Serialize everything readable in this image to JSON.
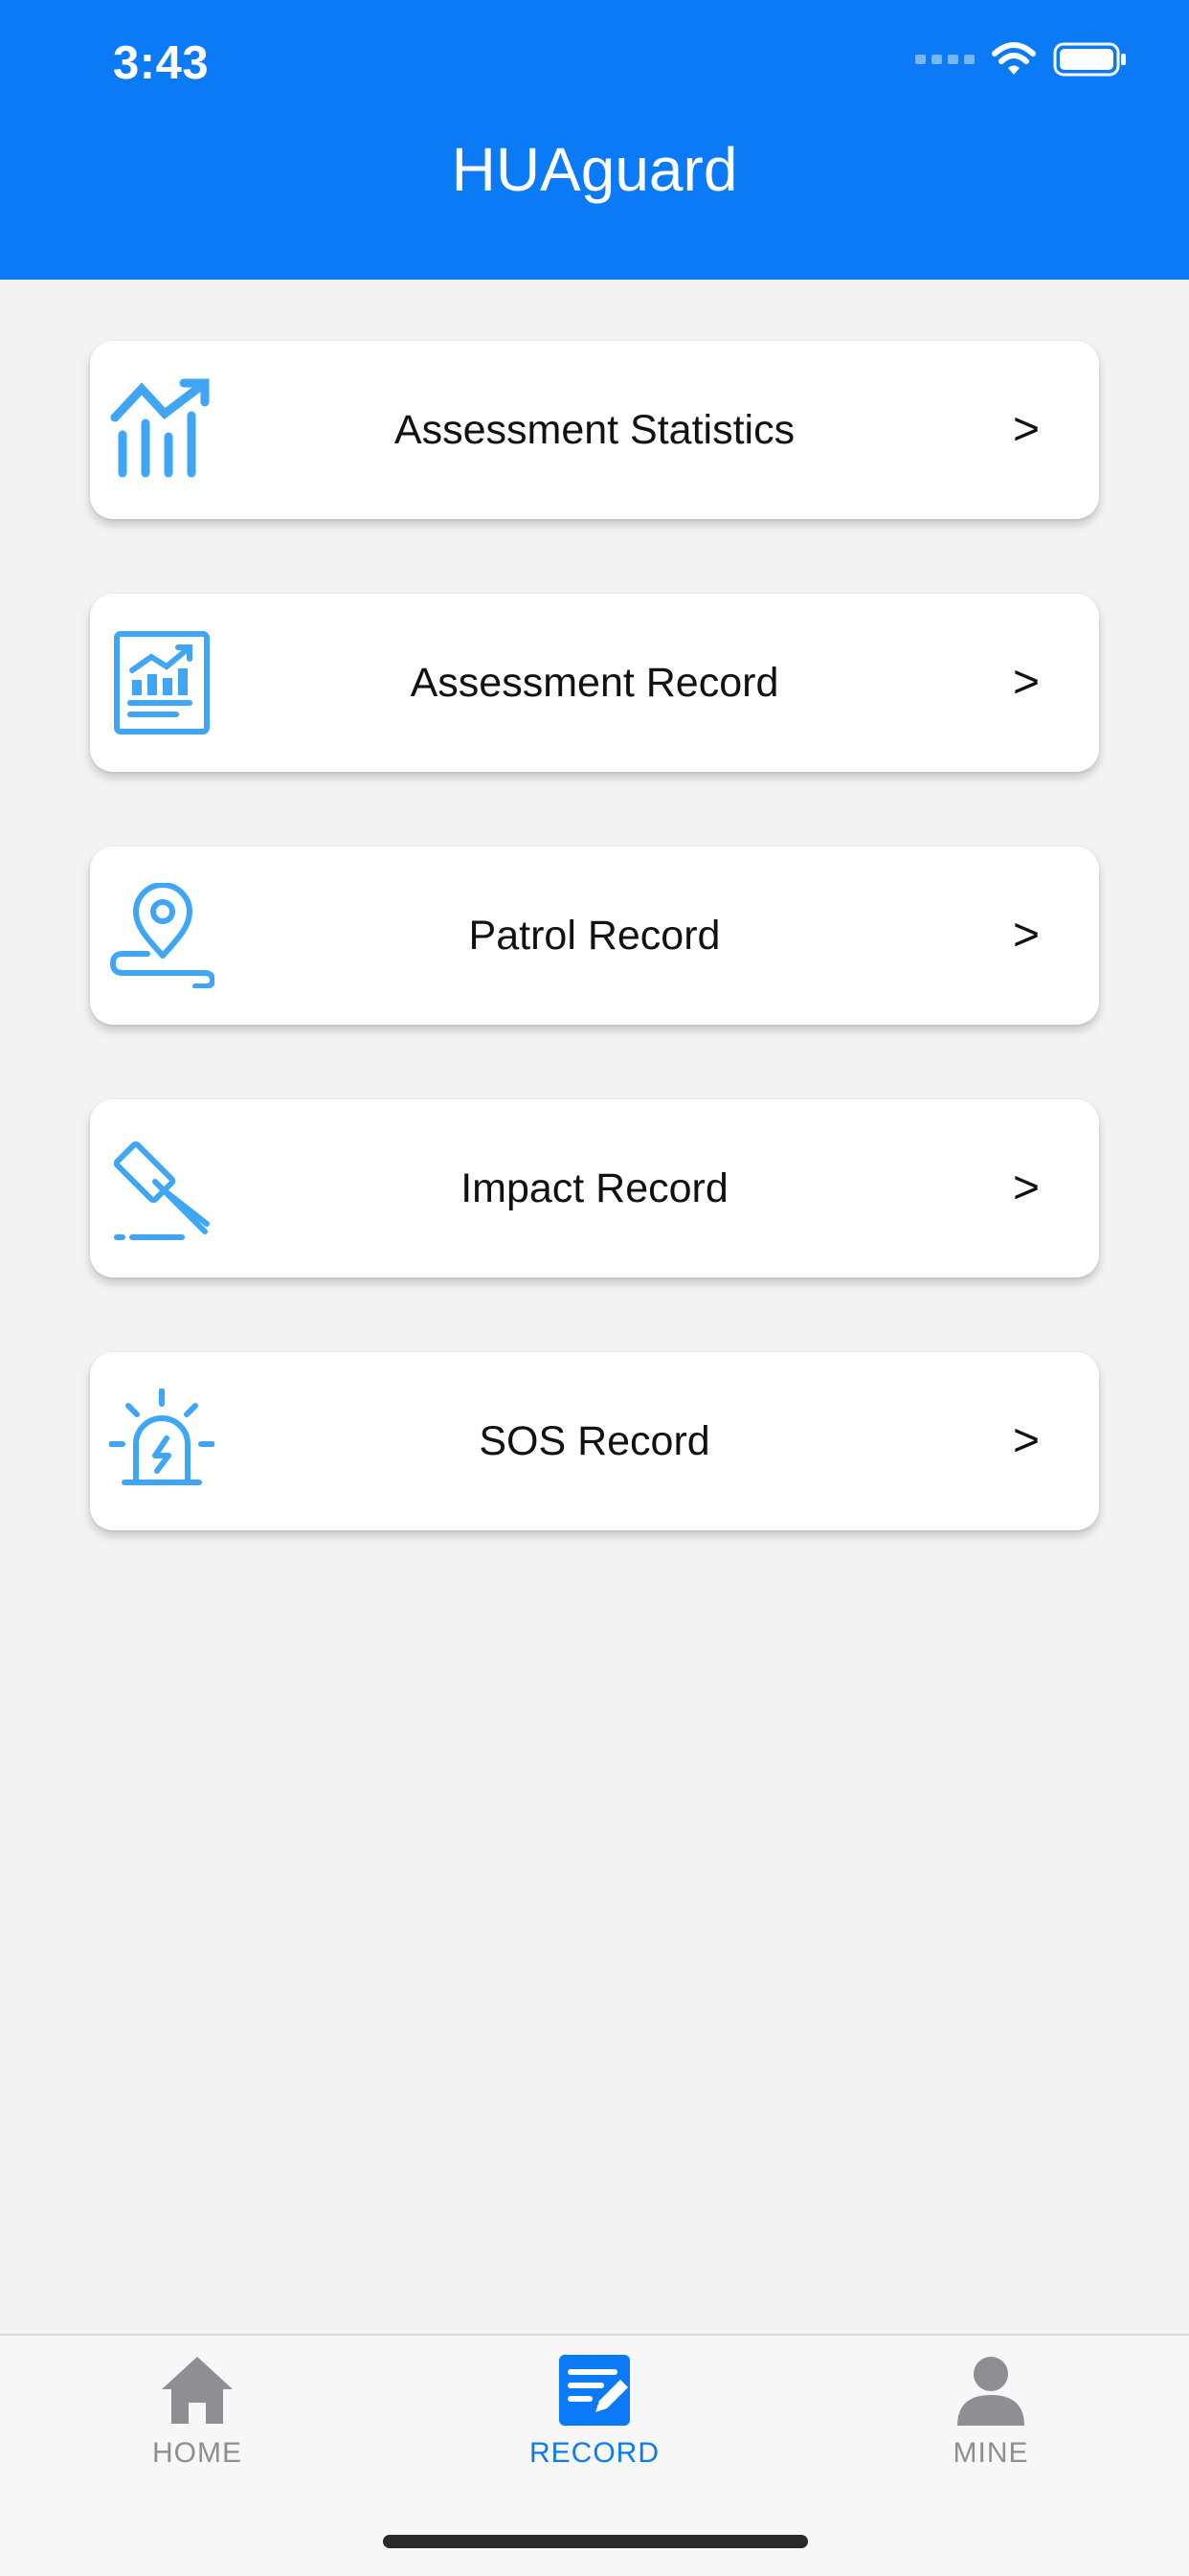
{
  "status": {
    "time": "3:43"
  },
  "app": {
    "title": "HUAguard"
  },
  "menu": [
    {
      "label": "Assessment Statistics",
      "chevron": ">",
      "icon": "trend-chart-icon"
    },
    {
      "label": "Assessment Record",
      "chevron": ">",
      "icon": "report-chart-icon"
    },
    {
      "label": "Patrol Record",
      "chevron": ">",
      "icon": "location-pin-icon"
    },
    {
      "label": "Impact Record",
      "chevron": ">",
      "icon": "gavel-icon"
    },
    {
      "label": "SOS Record",
      "chevron": ">",
      "icon": "alarm-siren-icon"
    }
  ],
  "tabs": [
    {
      "label": "HOME",
      "icon": "home-icon",
      "active": false
    },
    {
      "label": "RECORD",
      "icon": "record-edit-icon",
      "active": true
    },
    {
      "label": "MINE",
      "icon": "person-icon",
      "active": false
    }
  ],
  "colors": {
    "header": "#0a7af7",
    "icon": "#3fa6f5",
    "tab_active": "#0a7af7",
    "tab_inactive": "#8e8e93"
  }
}
